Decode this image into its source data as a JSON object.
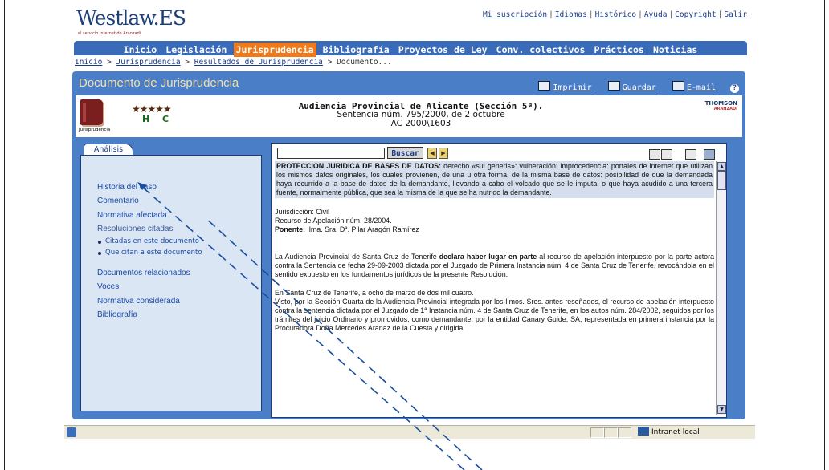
{
  "logo": {
    "text": "Westlaw.ES",
    "subtitle": "el servicio Internet de Aranzadi"
  },
  "toplinks": [
    "Mi suscripción",
    "Idiomas",
    "Histórico",
    "Ayuda",
    "Copyright",
    "Salir"
  ],
  "nav": [
    "Inicio",
    "Legislación",
    "Jurisprudencia",
    "Bibliografía",
    "Proyectos de Ley",
    "Conv. colectivos",
    "Prácticos",
    "Noticias"
  ],
  "nav_active": "Jurisprudencia",
  "breadcrumb": {
    "items": [
      "Inicio",
      "Jurisprudencia",
      "Resultados de Jurisprudencia"
    ],
    "current": "Documento..."
  },
  "page_title": "Documento de Jurisprudencia",
  "tools": {
    "print": "Imprimir",
    "save": "Guardar",
    "email": "E-mail",
    "help": "?"
  },
  "header": {
    "category": "Jurisprudencia",
    "stars": "★★★★★",
    "hc": "H C",
    "court": "Audiencia Provincial de Alicante (Sección 5ª).",
    "sentence": "Sentencia núm. 795/2000, de 2 octubre",
    "ref": "AC 2000\\1603",
    "publisher": "THOMSON",
    "publisher_sub": "ARANZADI"
  },
  "analysis": {
    "tab": "Análisis",
    "links": [
      "Historia del caso",
      "Comentario",
      "Normativa afectada",
      "Resoluciones citadas"
    ],
    "sublinks": [
      "Citadas en este documento",
      "Que citan a este documento"
    ],
    "links2": [
      "Documentos relacionados",
      "Voces",
      "Normativa considerada",
      "Bibliografía"
    ]
  },
  "search": {
    "value": "",
    "button": "Buscar"
  },
  "document": {
    "summary_bold": "PROTECCION JURIDICA DE BASES DE DATOS:",
    "summary_text": " derecho «sui generis»: vulneración: improcedencia: portales de internet que utilizan los mismos datos originales, los cuales provienen, de una u otra forma, de la misma base de datos: posibilidad de que la demandada haya recurrido a la base de datos de la demandante, llevando a cabo el volcado que se le imputa, o que haya acudido a una tercera fuente, normalmente pública, que sea la misma de la que se ha nutrido la demandante.",
    "jurisdiccion": "Jurisdicción: Civil",
    "recurso": "Recurso de Apelación núm. 28/2004.",
    "ponente_label": "Ponente:",
    "ponente": " Ilma. Sra. Dª. Pilar Aragón Ramírez",
    "p1_start": "La Audiencia Provincial de Santa Cruz de Tenerife ",
    "p1_bold": "declara haber lugar en parte",
    "p1_end": " al recurso de apelación interpuesto por la parte actora contra la Sentencia de fecha 29-09-2003 dictada por el Juzgado de Primera Instancia núm. 4 de Santa Cruz de Tenerife, revocándola en el sentido expuesto en los fundamentos jurídicos de la presente Resolución.",
    "p2": "En Santa Cruz de Tenerife, a ocho de marzo de dos mil cuatro.",
    "p3": "Visto, por la Sección Cuarta de la Audiencia Provincial integrada por los Ilmos. Sres. antes reseñados, el recurso de apelación interpuesto contra la sentencia dictada por el Juzgado de 1ª Instancia núm. 4 de Santa Cruz de Tenerife, en los autos núm. 284/2002, seguidos por los trámites del juicio Ordinario y promovidos, como demandante, por la entidad Canary Guide, SA, representada en primera instancia por la Procuradora Doña Mercedes Aranaz de la Cuesta y dirigida"
  },
  "status": {
    "zone": "Intranet local"
  },
  "colors": {
    "brand_blue": "#3a6bb8",
    "panel_blue": "#4a7fc8",
    "active_orange": "#f07a1a",
    "arrow": "#1a4fa0"
  }
}
